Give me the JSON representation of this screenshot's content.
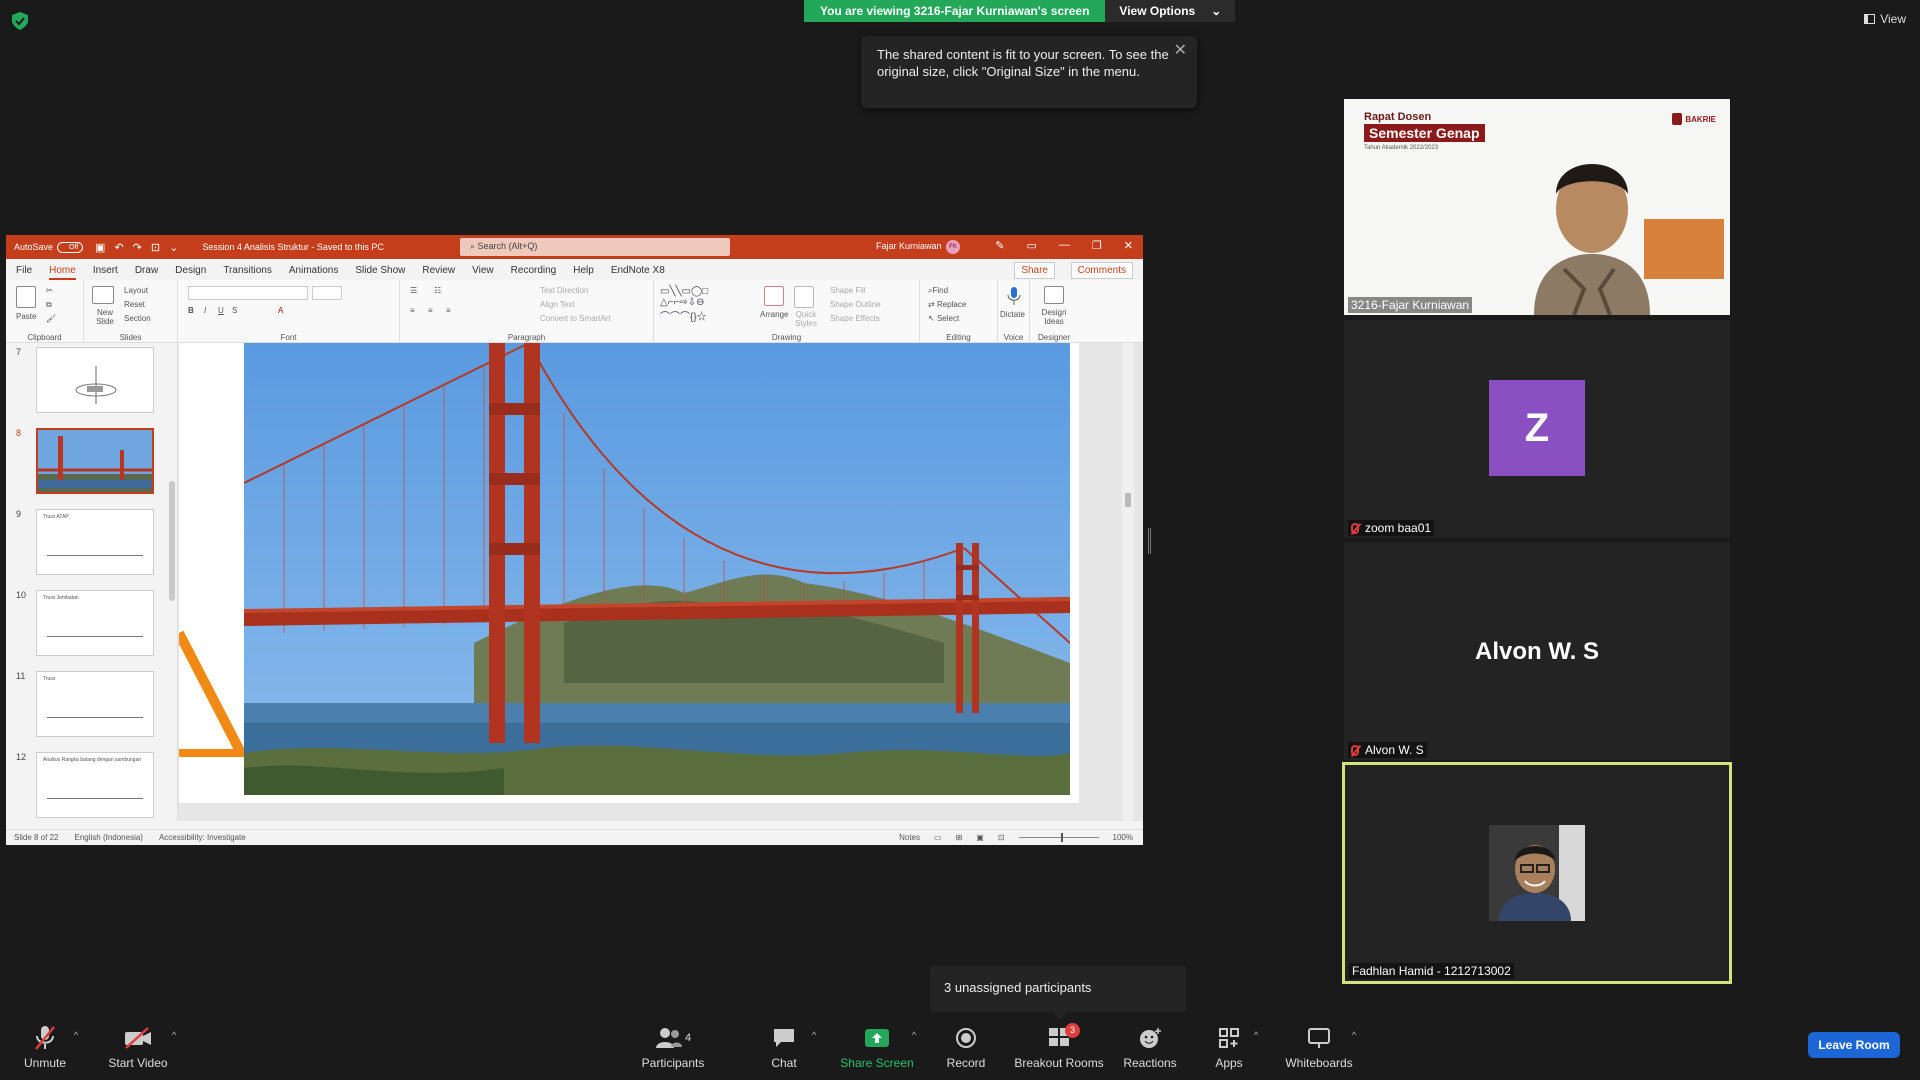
{
  "top": {
    "share_banner": "You are viewing 3216-Fajar Kurniawan's screen",
    "view_options": "View Options",
    "view_label": "View",
    "tooltip": "The shared content is fit to your screen. To see the original size, click \"Original Size\" in the menu."
  },
  "ppt": {
    "autosave_label": "AutoSave",
    "autosave_state": "Off",
    "doc_name": "Session 4 Analisis Struktur  -  Saved to this PC",
    "search_placeholder": "Search (Alt+Q)",
    "user_name": "Fajar Kurniawan",
    "user_initials": "FK",
    "menu": [
      "File",
      "Home",
      "Insert",
      "Draw",
      "Design",
      "Transitions",
      "Animations",
      "Slide Show",
      "Review",
      "View",
      "Recording",
      "Help",
      "EndNote X8"
    ],
    "active_menu": "Home",
    "share": "Share",
    "comments": "Comments",
    "ribbon": {
      "clipboard": "Clipboard",
      "paste": "Paste",
      "slides": "Slides",
      "new_slide": "New Slide",
      "layout": "Layout",
      "reset": "Reset",
      "section": "Section",
      "font": "Font",
      "paragraph": "Paragraph",
      "text_direction": "Text Direction",
      "align_text": "Align Text",
      "convert_smartart": "Convert to SmartArt",
      "drawing": "Drawing",
      "arrange": "Arrange",
      "quick_styles": "Quick Styles",
      "shape_fill": "Shape Fill",
      "shape_outline": "Shape Outline",
      "shape_effects": "Shape Effects",
      "editing": "Editing",
      "find": "Find",
      "replace": "Replace",
      "select": "Select",
      "voice": "Voice",
      "dictate": "Dictate",
      "designer": "Designer",
      "design_ideas": "Design Ideas"
    },
    "thumbnails": [
      {
        "num": "7",
        "title": ""
      },
      {
        "num": "8",
        "title": ""
      },
      {
        "num": "9",
        "title": "Truss ATAP"
      },
      {
        "num": "10",
        "title": "Truss Jembatan"
      },
      {
        "num": "11",
        "title": "Truss"
      },
      {
        "num": "12",
        "title": "Analisis Rangka batang dengan sambungan"
      }
    ],
    "status": {
      "slide": "Slide 8 of 22",
      "language": "English (Indonesia)",
      "accessibility": "Accessibility: Investigate",
      "notes": "Notes",
      "zoom": "100%"
    }
  },
  "gallery": {
    "tile1_name": "3216-Fajar Kurniawan",
    "tile1_rapat": "Rapat Dosen",
    "tile1_semester": "Semester Genap",
    "tile1_tahun": "Tahun Akademik 2022/2023",
    "tile1_logo": "BAKRIE",
    "tile2_initial": "Z",
    "tile2_name": "zoom baa01",
    "tile3_big": "Alvon W. S",
    "tile3_name": "Alvon W. S",
    "tile4_name": "Fadhlan Hamid - 1212713002"
  },
  "unassigned": "3 unassigned participants",
  "toolbar": {
    "unmute": "Unmute",
    "start_video": "Start Video",
    "participants": "Participants",
    "participants_count": "4",
    "chat": "Chat",
    "share_screen": "Share Screen",
    "record": "Record",
    "breakout_rooms": "Breakout Rooms",
    "breakout_badge": "3",
    "reactions": "Reactions",
    "apps": "Apps",
    "whiteboards": "Whiteboards",
    "leave_room": "Leave Room"
  },
  "colors": {
    "ppt_accent": "#c43e1c",
    "zoom_green": "#23a85a",
    "leave_blue": "#1d66d6",
    "active_speaker": "#d2e37c",
    "avatar_purple": "#8a4fc0"
  }
}
